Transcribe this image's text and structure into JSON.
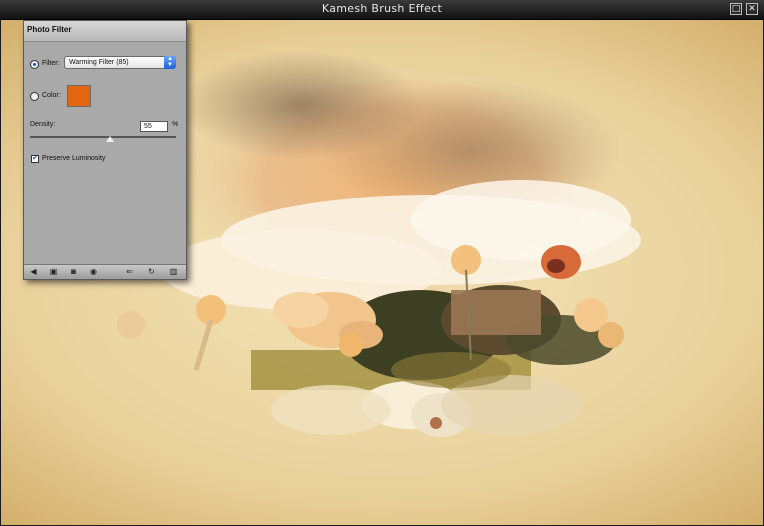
{
  "window": {
    "title": "Kamesh Brush Effect",
    "maximize_icon": "maximize-icon",
    "close_icon": "close-icon"
  },
  "panel": {
    "title": "Photo Filter",
    "filter": {
      "label": "Filter:",
      "value": "Warming Filter (85)",
      "selected": true
    },
    "color": {
      "label": "Color:",
      "swatch": "#e36511",
      "selected": false
    },
    "density": {
      "label": "Density:",
      "value": "55",
      "unit": "%",
      "level": 0.55
    },
    "preserve_luminosity": {
      "label": "Preserve Luminosity",
      "checked": true
    },
    "footer_icons": [
      "history-back-icon",
      "snapshot-icon",
      "layer-mask-icon",
      "eye-icon",
      "link-icon",
      "refresh-icon",
      "trash-icon"
    ]
  },
  "colors": {
    "accent": "#1b56c4",
    "swatch": "#e36511",
    "panel_bg": "#a9a9a9"
  }
}
